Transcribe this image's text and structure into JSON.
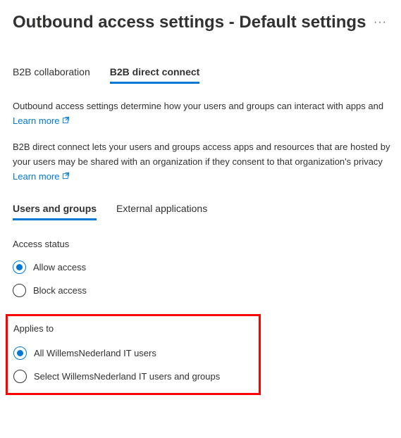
{
  "header": {
    "title": "Outbound access settings - Default settings"
  },
  "tabs": {
    "collaboration": "B2B collaboration",
    "direct_connect": "B2B direct connect"
  },
  "description1": "Outbound access settings determine how your users and groups can interact with apps and",
  "learn_more": "Learn more",
  "description2a": "B2B direct connect lets your users and groups access apps and resources that are hosted by",
  "description2b": "your users may be shared with an organization if they consent to that organization's privacy",
  "subtabs": {
    "users_groups": "Users and groups",
    "external_apps": "External applications"
  },
  "access_status": {
    "label": "Access status",
    "allow": "Allow access",
    "block": "Block access"
  },
  "applies_to": {
    "label": "Applies to",
    "all_users": "All WillemsNederland IT users",
    "select_users": "Select WillemsNederland IT users and groups"
  }
}
